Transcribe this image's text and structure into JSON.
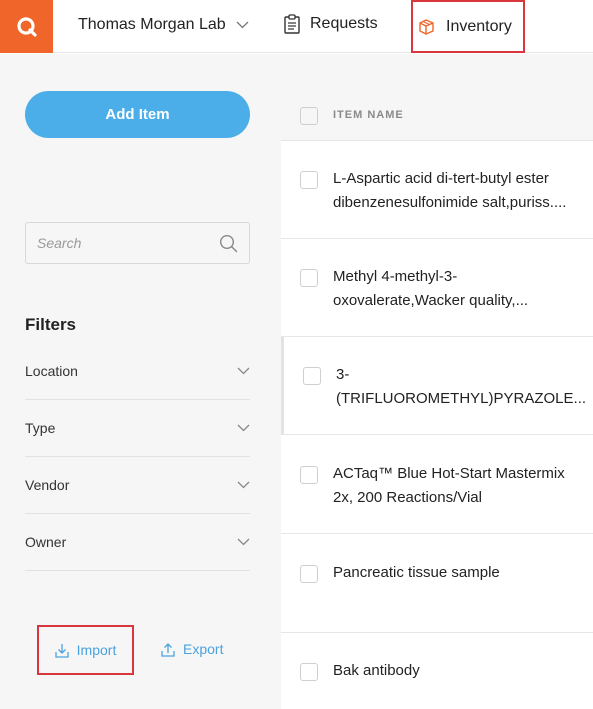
{
  "topbar": {
    "logo_letter": "Q",
    "lab_name": "Thomas Morgan Lab",
    "nav": {
      "requests_label": "Requests",
      "inventory_label": "Inventory"
    }
  },
  "sidebar": {
    "add_item_label": "Add Item",
    "search_placeholder": "Search",
    "filters_title": "Filters",
    "filters": [
      "Location",
      "Type",
      "Vendor",
      "Owner"
    ],
    "import_label": "Import",
    "export_label": "Export"
  },
  "list": {
    "column_header": "ITEM NAME",
    "items": [
      "L-Aspartic acid di-tert-butyl ester dibenzenesulfonimide salt,puriss....",
      "Methyl 4-methyl-3-oxovalerate,Wacker quality,...",
      "3-(TRIFLUOROMETHYL)PYRAZOLE...",
      "ACTaq™ Blue Hot-Start Mastermix 2x, 200 Reactions/Vial",
      "Pancreatic tissue sample",
      "Bak antibody"
    ]
  },
  "colors": {
    "brand_orange": "#f0652a",
    "primary_blue": "#4baee8",
    "link_blue": "#4aa3df",
    "highlight_red": "#d9363e"
  }
}
